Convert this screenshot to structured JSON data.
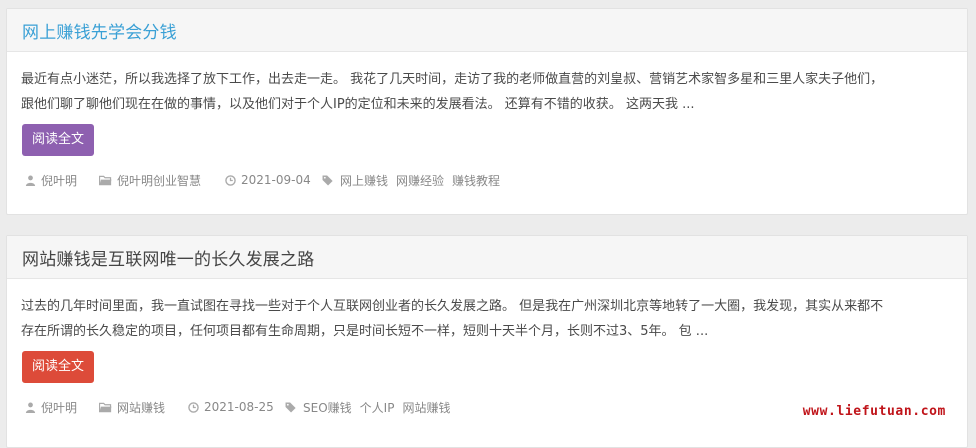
{
  "posts": [
    {
      "title": "网上赚钱先学会分钱",
      "title_color": "#3aa0d5",
      "excerpt_line1": "最近有点小迷茫，所以我选择了放下工作，出去走一走。 我花了几天时间，走访了我的老师做直营的刘皇叔、营销艺术家智多星和三里人家夫子他们，",
      "excerpt_line2": "跟他们聊了聊他们现在在做的事情，以及他们对于个人IP的定位和未来的发展看法。 还算有不错的收获。 这两天我 ...",
      "read_more": "阅读全文",
      "button_color": "#8e60b0",
      "author": "倪叶明",
      "category": "倪叶明创业智慧",
      "date": "2021-09-04",
      "tags": [
        "网上赚钱",
        "网赚经验",
        "赚钱教程"
      ]
    },
    {
      "title": "网站赚钱是互联网唯一的长久发展之路",
      "title_color": "#444444",
      "excerpt_line1": "过去的几年时间里面，我一直试图在寻找一些对于个人互联网创业者的长久发展之路。 但是我在广州深圳北京等地转了一大圈，我发现，其实从来都不",
      "excerpt_line2": "存在所谓的长久稳定的项目，任何项目都有生命周期，只是时间长短不一样，短则十天半个月，长则不过3、5年。 包 ...",
      "read_more": "阅读全文",
      "button_color": "#dd4b39",
      "author": "倪叶明",
      "category": "网站赚钱",
      "date": "2021-08-25",
      "tags": [
        "SEO赚钱",
        "个人IP",
        "网站赚钱"
      ]
    }
  ],
  "watermark": "www.liefutuan.com",
  "icons": [
    "user-icon",
    "folder-icon",
    "clock-icon",
    "tag-icon"
  ]
}
